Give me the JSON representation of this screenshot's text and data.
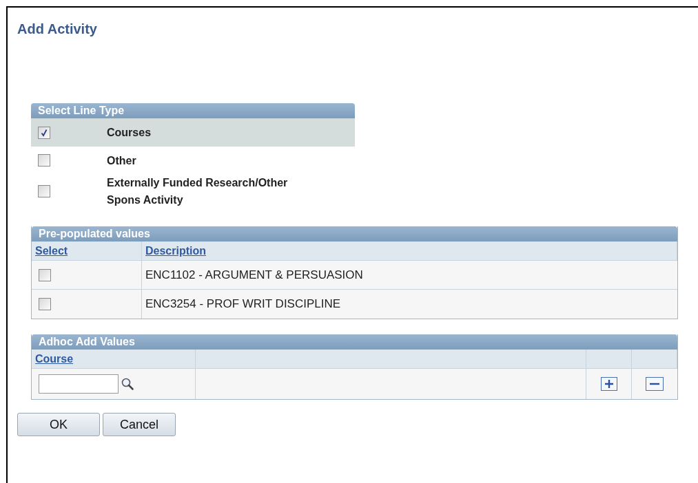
{
  "title": "Add Activity",
  "line_type": {
    "heading": "Select Line Type",
    "options": [
      {
        "label": "Courses",
        "checked": true,
        "selected": true
      },
      {
        "label": "Other",
        "checked": false,
        "selected": false
      },
      {
        "label": "Externally Funded Research/Other Spons Activity",
        "checked": false,
        "selected": false
      }
    ]
  },
  "prepopulated": {
    "heading": "Pre-populated values",
    "columns": [
      "Select",
      "Description"
    ],
    "rows": [
      {
        "checked": false,
        "description": "ENC1102 - ARGUMENT & PERSUASION"
      },
      {
        "checked": false,
        "description": "ENC3254 - PROF WRIT DISCIPLINE"
      }
    ]
  },
  "adhoc": {
    "heading": "Adhoc Add Values",
    "columns": [
      "Course"
    ]
  },
  "buttons": [
    "OK",
    "Cancel"
  ]
}
